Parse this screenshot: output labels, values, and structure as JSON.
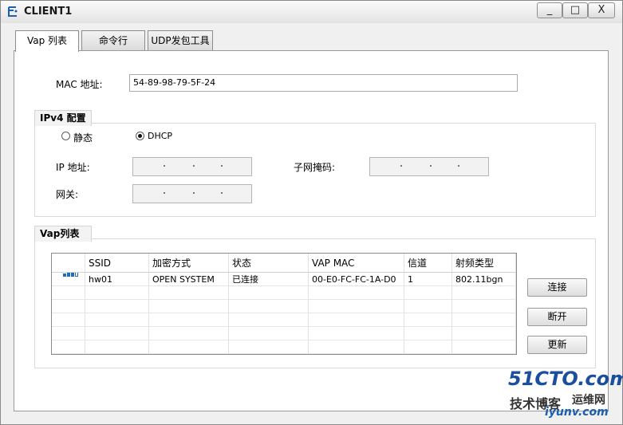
{
  "window": {
    "title": "CLIENT1",
    "minimize": "_",
    "maximize": "□",
    "close": "X"
  },
  "tabs": [
    {
      "label": "Vap 列表"
    },
    {
      "label": "命令行"
    },
    {
      "label": "UDP发包工具"
    }
  ],
  "mac": {
    "label": "MAC 地址:",
    "value": "54-89-98-79-5F-24"
  },
  "ipv4": {
    "title": "IPv4 配置",
    "static_label": "静态",
    "dhcp_label": "DHCP",
    "selected": "DHCP",
    "ip_label": "IP 地址:",
    "mask_label": "子网掩码:",
    "gateway_label": "网关:"
  },
  "vap": {
    "title": "Vap列表",
    "columns": [
      "SSID",
      "加密方式",
      "状态",
      "VAP MAC",
      "信道",
      "射频类型"
    ],
    "rows": [
      {
        "ssid": "hw01",
        "enc": "OPEN SYSTEM",
        "status": "已连接",
        "mac": "00-E0-FC-FC-1A-D0",
        "channel": "1",
        "radio": "802.11bgn"
      }
    ]
  },
  "buttons": {
    "connect": "连接",
    "disconnect": "断开",
    "refresh": "更新"
  },
  "watermark": {
    "line1": "51CTO.com",
    "line2": "技术博客",
    "line3": "运维网",
    "line4": "iyunv.com"
  },
  "colors": {
    "signal": "#1c6fb8",
    "watermark_blue": "#1a4fa0"
  },
  "icons": {
    "app": "network-client-icon",
    "signal": "signal-strength-icon"
  }
}
